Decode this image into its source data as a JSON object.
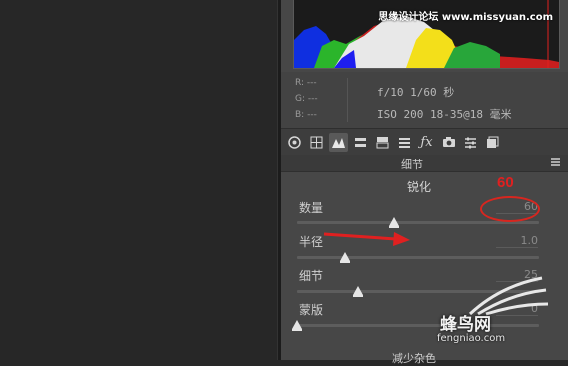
{
  "watermark_top": "思缘设计论坛 www.missyuan.com",
  "info": {
    "rgb": [
      "R: ---",
      "G: ---",
      "B: ---"
    ],
    "exif_line1": "f/10  1/60 秒",
    "exif_line2": "ISO 200  18-35@18 毫米"
  },
  "toolbar": {
    "icons": [
      "aperture-icon",
      "grid-icon",
      "tone-curve-icon",
      "hsl-icon",
      "split-tone-icon",
      "detail-icon",
      "fx-icon",
      "camera-icon",
      "presets-icon",
      "snapshots-icon"
    ]
  },
  "panel": {
    "section_title": "细节",
    "group_title": "锐化",
    "sliders": [
      {
        "label": "数量",
        "value": "60",
        "level": 0.4
      },
      {
        "label": "半径",
        "value": "1.0",
        "level": 0.2
      },
      {
        "label": "细节",
        "value": "25",
        "level": 0.25
      },
      {
        "label": "蒙版",
        "value": "0",
        "level": 0.0
      }
    ],
    "bottom_title": "减少杂色"
  },
  "annotation": {
    "value": "60",
    "color": "#e02020"
  },
  "watermark": {
    "text": "蜂鸟网",
    "url": "fengniao.com"
  }
}
